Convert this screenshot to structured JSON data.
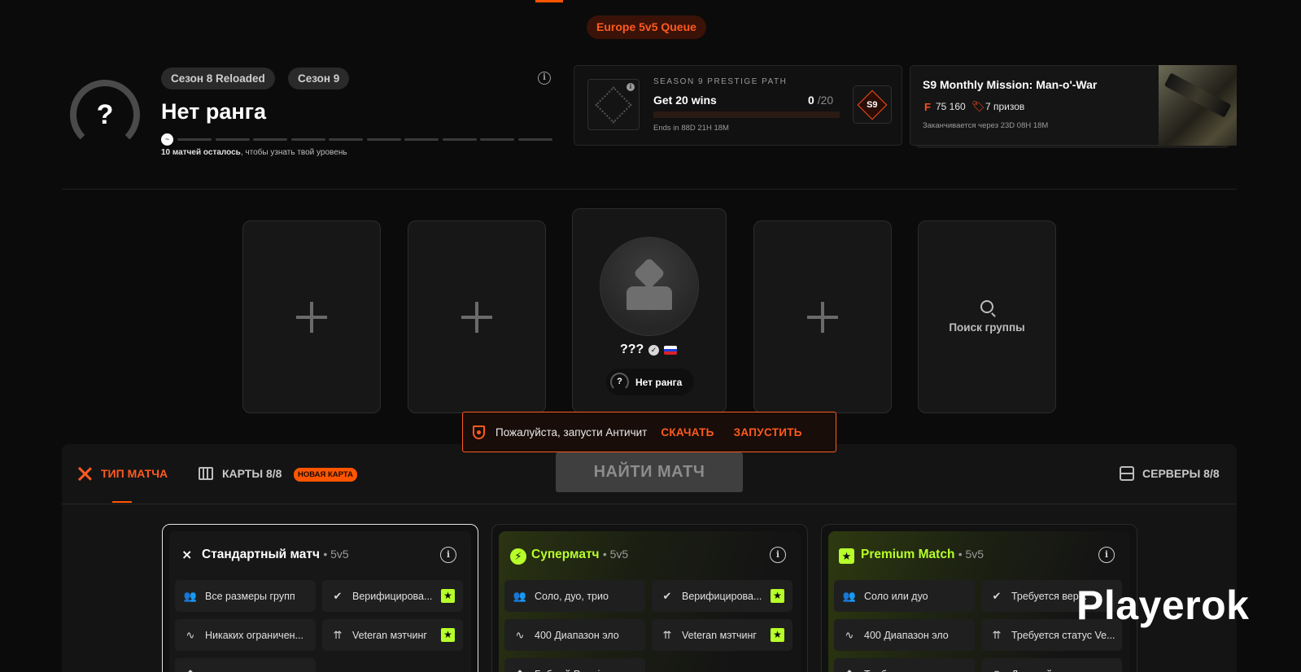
{
  "queue": {
    "label": "Europe 5v5 Queue"
  },
  "rank": {
    "icon": "?",
    "seasons": [
      "Сезон 8 Reloaded",
      "Сезон 9"
    ],
    "title": "Нет ранга",
    "matches_left_bold": "10 матчей осталось",
    "matches_left_rest": ", чтобы узнать твой уровень",
    "progress_segments": 10,
    "progress_filled": 0
  },
  "prestige": {
    "label": "SEASON 9 PRESTIGE PATH",
    "goal": "Get 20 wins",
    "current": "0",
    "total": "/20",
    "ends": "Ends in 88D 21H 18M",
    "badge": "S9",
    "progress": 0
  },
  "mission": {
    "title": "S9 Monthly Mission: Man-o'-War",
    "currency_icon": "F",
    "points": "75 160",
    "prizes": "7 призов",
    "ends": "Заканчивается через 23D 08H 18M"
  },
  "party": {
    "player_name": "???",
    "player_rank_icon": "?",
    "player_rank": "Нет ранга",
    "flag_colors": [
      "#ffffff",
      "#1c3fd8",
      "#d8222a"
    ],
    "search_label": "Поиск группы"
  },
  "anticheat": {
    "message": "Пожалуйста, запусти Античит",
    "download": "СКАЧАТЬ",
    "launch": "ЗАПУСТИТЬ"
  },
  "tabs": {
    "match_type": "ТИП МАТЧА",
    "maps": "КАРТЫ 8/8",
    "new_map_badge": "НОВАЯ КАРТА",
    "find_match": "НАЙТИ МАТЧ",
    "servers": "СЕРВЕРЫ 8/8"
  },
  "modes": [
    {
      "name": "Стандартный матч",
      "sub": "• 5v5",
      "color": "#ffffff",
      "features": [
        {
          "icon": "users-icon",
          "label": "Все размеры групп"
        },
        {
          "icon": "verified-icon",
          "label": "Верифицирова...",
          "star": true
        },
        {
          "icon": "elo-icon",
          "label": "Никаких ограничен..."
        },
        {
          "icon": "veteran-icon",
          "label": "Veteran мэтчинг",
          "star": true
        },
        {
          "icon": "boost-icon",
          "label": ""
        }
      ]
    },
    {
      "name": "Суперматч",
      "sub": "• 5v5",
      "color": "#b7ff2a",
      "features": [
        {
          "icon": "users-icon",
          "label": "Соло, дуо, трио"
        },
        {
          "icon": "verified-icon",
          "label": "Верифицирова...",
          "star": true
        },
        {
          "icon": "elo-icon",
          "label": "400 Диапазон эло"
        },
        {
          "icon": "veteran-icon",
          "label": "Veteran мэтчинг",
          "star": true
        },
        {
          "icon": "boost-icon",
          "label": "Бубный Premium"
        }
      ]
    },
    {
      "name": "Premium Match",
      "sub": "• 5v5",
      "color": "#b7ff2a",
      "features": [
        {
          "icon": "users-icon",
          "label": "Соло или дуо"
        },
        {
          "icon": "verified-icon",
          "label": "Требуется вер..."
        },
        {
          "icon": "elo-icon",
          "label": "400 Диапазон эло"
        },
        {
          "icon": "veteran-icon",
          "label": "Требуется статус Ve..."
        },
        {
          "icon": "boost-icon",
          "label": "Требуется премиум"
        },
        {
          "icon": "clock-icon",
          "label": "Дальнейшие этапы"
        }
      ]
    }
  ],
  "watermark": "Playerok",
  "colors": {
    "accent": "#ff5500",
    "lime": "#b7ff2a",
    "bg": "#0b0b0b"
  }
}
